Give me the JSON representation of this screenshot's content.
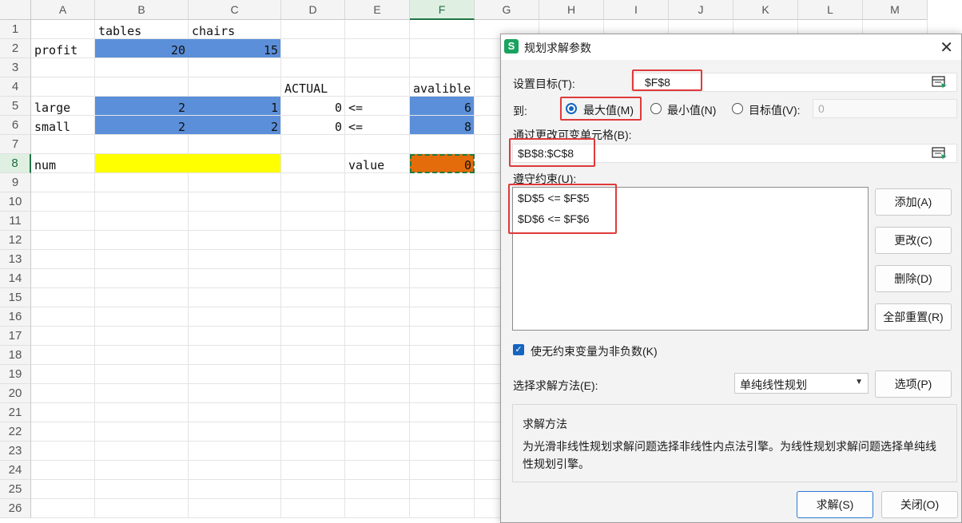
{
  "sheet": {
    "columns": [
      "A",
      "B",
      "C",
      "D",
      "E",
      "F",
      "G",
      "H",
      "I",
      "J",
      "K",
      "L",
      "M"
    ],
    "rows": [
      "1",
      "2",
      "3",
      "4",
      "5",
      "6",
      "7",
      "8",
      "9",
      "10",
      "11",
      "12",
      "13",
      "14",
      "15",
      "16",
      "17",
      "18",
      "19",
      "20",
      "21",
      "22",
      "23",
      "24",
      "25",
      "26"
    ],
    "cells": {
      "B1": "tables",
      "C1": "chairs",
      "A2": "profit",
      "B2": "20",
      "C2": "15",
      "D4": "ACTUAL",
      "F4": "avalible",
      "A5": "large",
      "B5": "2",
      "C5": "1",
      "D5": "0",
      "E5": "<=",
      "F5": "6",
      "A6": "small",
      "B6": "2",
      "C6": "2",
      "D6": "0",
      "E6": "<=",
      "F6": "8",
      "A8": "num",
      "E8": "value",
      "F8": "0"
    },
    "colors": {
      "blue": "#5b8fd9",
      "yellow": "#ffff00",
      "orange": "#e46c0a"
    }
  },
  "dialog": {
    "title": "规划求解参数",
    "app_icon": "S",
    "close": "✕",
    "objective_label": "设置目标(T):",
    "objective_value": "$F$8",
    "to_label": "到:",
    "radio_max": "最大值(M)",
    "radio_min": "最小值(N)",
    "radio_value": "目标值(V):",
    "target_value": "0",
    "changing_label": "通过更改可变单元格(B):",
    "changing_value": "$B$8:$C$8",
    "constraints_label": "遵守约束(U):",
    "constraints": [
      "$D$5 <= $F$5",
      "$D$6 <= $F$6"
    ],
    "btn_add": "添加(A)",
    "btn_change": "更改(C)",
    "btn_delete": "删除(D)",
    "btn_reset": "全部重置(R)",
    "checkbox_label": "使无约束变量为非负数(K)",
    "method_label": "选择求解方法(E):",
    "method_value": "单纯线性规划",
    "btn_options": "选项(P)",
    "desc_title": "求解方法",
    "desc_text": "为光滑非线性规划求解问题选择非线性内点法引擎。为线性规划求解问题选择单纯线性规划引擎。",
    "btn_solve": "求解(S)",
    "btn_close": "关闭(O)"
  }
}
